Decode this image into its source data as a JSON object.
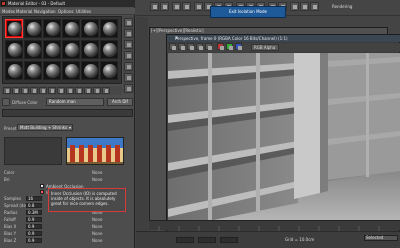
{
  "material_editor": {
    "title": "Material Editor - 03 - Default",
    "menu": [
      "Modes",
      "Material",
      "Navigation",
      "Options",
      "Utilities"
    ],
    "material_name": "Random man",
    "material_type_label": "Arch Dif",
    "diffuse_label": "Diffuse Color",
    "preset_label": "Preset:",
    "preset_value": "Matt Building + Shrinks",
    "preset_indicator": "▾",
    "rollout_header": "",
    "properties": [
      {
        "label": "Color",
        "value": "",
        "map": "None"
      },
      {
        "label": "Bri",
        "value": "",
        "map": "None"
      }
    ],
    "ao_checks": [
      {
        "label": "Ambient Occlusion",
        "checked": true
      },
      {
        "label": "Inner Occlusion",
        "checked": true
      }
    ],
    "sample_props": [
      {
        "label": "Samples",
        "value": "16",
        "map": "None"
      },
      {
        "label": "Spread (deg)",
        "value": "0.8",
        "map": "None"
      },
      {
        "label": "Radius",
        "value": "0.3M",
        "map": "None"
      },
      {
        "label": "Falloff",
        "value": "0.9",
        "map": "None"
      },
      {
        "label": "Bias X",
        "value": "0.9",
        "map": "None"
      },
      {
        "label": "Bias Y",
        "value": "0.9",
        "map": "None"
      },
      {
        "label": "Bias Z",
        "value": "0.9",
        "map": "None"
      }
    ],
    "tooltip": "Inner Occlusion (IO) is computed inside of objects. It is absolutely great for nice corners edges."
  },
  "main": {
    "isolation_banner": "Exit Isolation Mode",
    "rendering_label": "Rendering",
    "viewport_label": "[+][Perspective][Realistic]",
    "vfb": {
      "title": "Perspective, frame 0 (RGBA Color 16 Bits/Channel) (1:1)",
      "close": "✕",
      "channel": "RGB Alpha"
    },
    "status": {
      "grid": "Grid = 10.0cm",
      "selection": "Selected"
    }
  },
  "colors": {
    "accent_red": "#ff3b3b",
    "banner_blue": "#1e5a99"
  }
}
